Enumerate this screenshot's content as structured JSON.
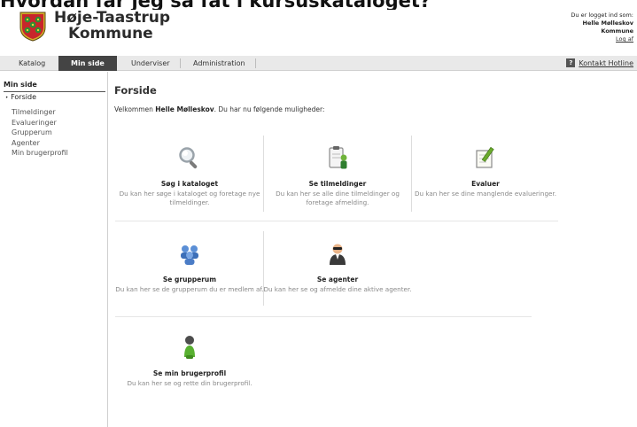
{
  "doc_heading": "Hvordan får jeg så fat i kursuskataloget?",
  "header": {
    "logo_line1": "Høje-Taastrup",
    "logo_line2": "Kommune",
    "login_label": "Du er logget ind som:",
    "user_name": "Helle Mølleskov",
    "user_org": "Kommune",
    "logout": "Log af"
  },
  "nav": {
    "items": [
      "Katalog",
      "Min side",
      "Underviser",
      "Administration"
    ],
    "hotline": "Kontakt Hotline",
    "hotline_icon": "?"
  },
  "sidebar": {
    "title": "Min side",
    "current": "Forside",
    "items": [
      "Tilmeldinger",
      "Evalueringer",
      "Grupperum",
      "Agenter",
      "Min brugerprofil"
    ]
  },
  "main": {
    "title": "Forside",
    "welcome_prefix": "Velkommen ",
    "welcome_name": "Helle Mølleskov",
    "welcome_suffix": ". Du har nu følgende muligheder:",
    "tiles": [
      {
        "title": "Søg i kataloget",
        "desc": "Du kan her søge i kataloget og foretage nye tilmeldinger.",
        "icon": "magnifier-icon"
      },
      {
        "title": "Se tilmeldinger",
        "desc": "Du kan her se alle dine tilmeldinger og foretage afmelding.",
        "icon": "clipboard-user-icon"
      },
      {
        "title": "Evaluer",
        "desc": "Du kan her se dine manglende evalueringer.",
        "icon": "notepad-pen-icon"
      },
      {
        "title": "Se grupperum",
        "desc": "Du kan her se de grupperum du er medlem af.",
        "icon": "group-icon"
      },
      {
        "title": "Se agenter",
        "desc": "Du kan her se og afmelde dine aktive agenter.",
        "icon": "agent-icon"
      },
      {
        "title": "Se min brugerprofil",
        "desc": "Du kan her se og rette din brugerprofil.",
        "icon": "user-profile-icon"
      }
    ]
  }
}
